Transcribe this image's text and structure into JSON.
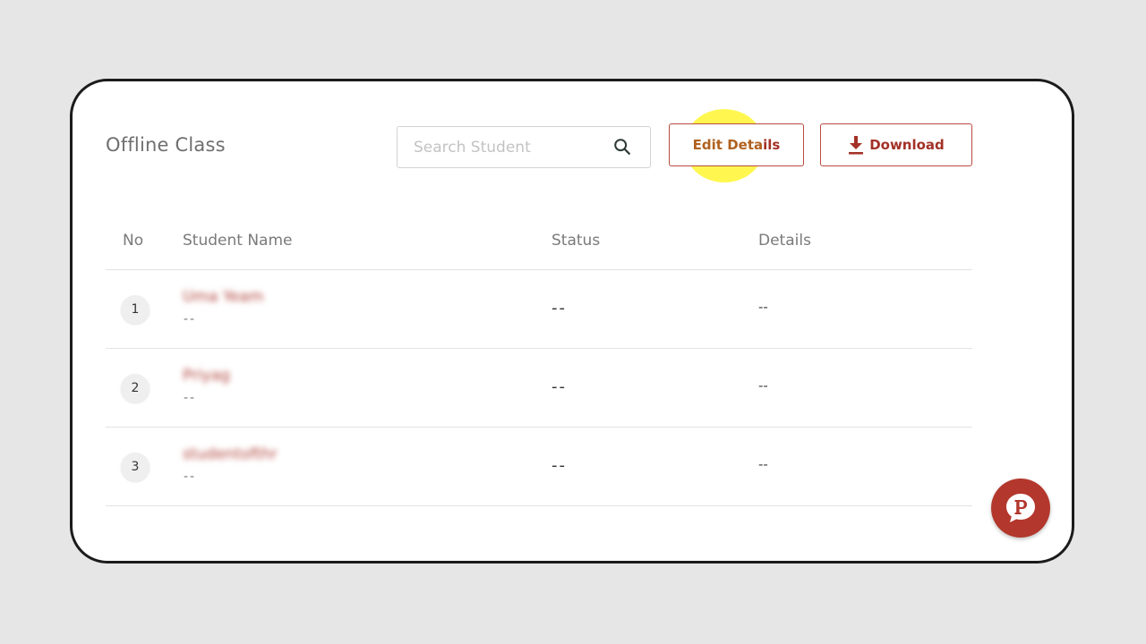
{
  "page": {
    "title": "Offline Class"
  },
  "search": {
    "placeholder": "Search Student",
    "icon": "search-icon"
  },
  "toolbar": {
    "edit_label_main": "Edit Deta",
    "edit_label_tail": "ils",
    "download_label": "Download",
    "download_icon": "download-icon"
  },
  "table": {
    "columns": [
      "No",
      "Student Name",
      "Status",
      "Details"
    ],
    "rows": [
      {
        "no": "1",
        "name": "Uma Yeam",
        "sub": "--",
        "status": "--",
        "details": "--"
      },
      {
        "no": "2",
        "name": "Priyag",
        "sub": "--",
        "status": "--",
        "details": "--"
      },
      {
        "no": "3",
        "name": "studentofthr",
        "sub": "--",
        "status": "--",
        "details": "--"
      }
    ]
  },
  "fab": {
    "icon": "chat-p-logo-icon"
  },
  "colors": {
    "accent": "#a33127",
    "border_accent": "#b84a40",
    "highlight": "#fff528",
    "background": "#e6e6e6"
  }
}
